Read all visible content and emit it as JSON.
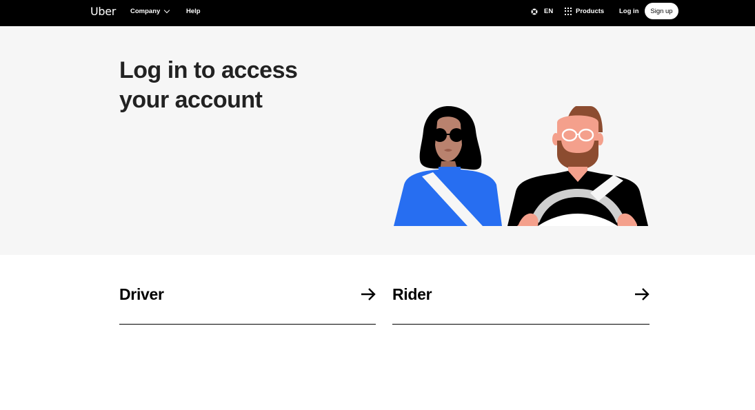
{
  "header": {
    "logo": "Uber",
    "nav_left": [
      {
        "label": "Company",
        "has_dropdown": true
      },
      {
        "label": "Help"
      }
    ],
    "language": {
      "icon": "globe-icon",
      "label": "EN"
    },
    "products": {
      "icon": "grid-icon",
      "label": "Products"
    },
    "login_label": "Log in",
    "signup_label": "Sign up"
  },
  "hero": {
    "title_line1": "Log in to access",
    "title_line2": "your account",
    "illustration": "rider-and-driver-illustration",
    "colors": {
      "background": "#f6f6f6",
      "rider_shirt": "#276ef1",
      "skin_rider": "#b9826e",
      "skin_driver": "#f4a08c",
      "beard": "#8c4c30",
      "steering_wheel": "#cfcfcf"
    }
  },
  "options": [
    {
      "label": "Driver",
      "icon": "arrow-right-icon"
    },
    {
      "label": "Rider",
      "icon": "arrow-right-icon"
    }
  ]
}
